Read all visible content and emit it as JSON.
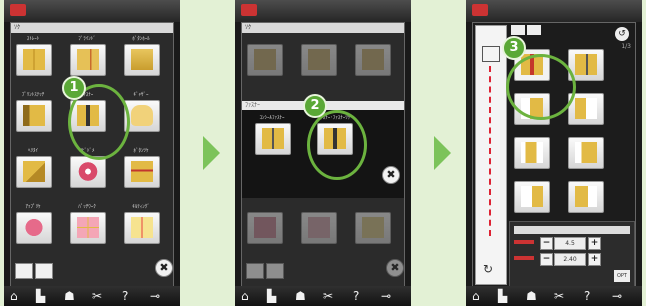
{
  "colors": {
    "background": "#e3f1d5",
    "accent": "#6cb33f",
    "arrow": "#7cc35a",
    "highlight": "#c33"
  },
  "steps": [
    "1",
    "2",
    "3"
  ],
  "screen1": {
    "header": "ｿｸ",
    "labels": [
      "ｽﾄﾚｰﾄ",
      "ﾌﾞﾗｲﾝﾄﾞ",
      "ﾎﾞﾀﾝﾎｰﾙ",
      "ﾌﾟﾘﾝﾄｽﾃｯﾁ",
      "ﾌｧｽﾅｰ",
      "ｷﾞｬｻﾞｰ",
      "ﾍﾘﾇｲ",
      "ｵﾋﾞﾄﾞﾒ",
      "ﾎﾞﾀﾝﾂｹ",
      "ｱｯﾌﾟﾘｹ",
      "ﾊﾟｯﾁﾜｰｸ",
      "ｷﾙﾃｨﾝｸﾞ"
    ]
  },
  "screen2": {
    "subheader": "ﾌｧｽﾅｰ",
    "labels": [
      "ｺﾝｼｰﾙﾌｧｽﾅｰ",
      "ﾌｧｽﾅｰ･ﾌｧｽﾅｰﾂｹ"
    ]
  },
  "screen3": {
    "page": "1/3",
    "values": [
      "4.5",
      "2.40"
    ],
    "opt_label": "OPT"
  },
  "bottom_icons": [
    "home-icon",
    "machine-icon",
    "shirt-icon",
    "settings-icon",
    "help-icon",
    "needle-icon"
  ],
  "bottom_glyphs": [
    "⌂",
    "▙",
    "☗",
    "✂",
    "?",
    "⊸"
  ],
  "close_glyph": "✖"
}
